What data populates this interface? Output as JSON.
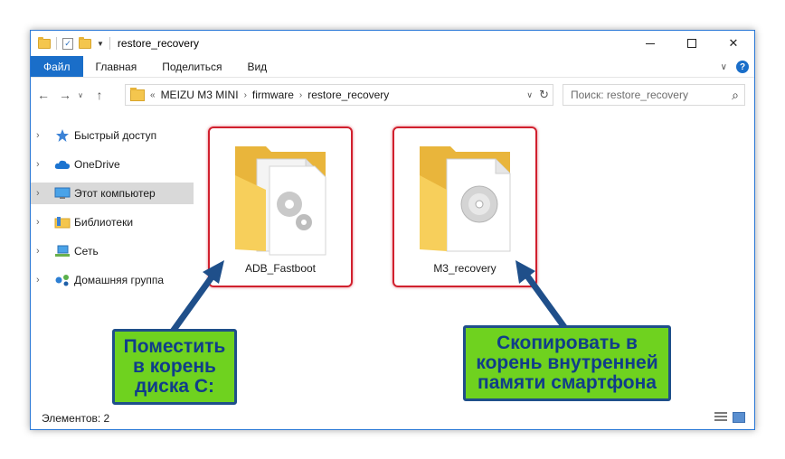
{
  "window": {
    "title": "restore_recovery",
    "minimize": "—",
    "maximize": "□",
    "close": "✕"
  },
  "ribbon": {
    "tabs": [
      "Файл",
      "Главная",
      "Поделиться",
      "Вид"
    ],
    "collapse": "∨",
    "help": "?"
  },
  "nav": {
    "back": "←",
    "forward": "→",
    "recent": "∨",
    "up": "↑"
  },
  "address": {
    "overflow": "«",
    "crumbs": [
      "MEIZU M3 MINI",
      "firmware",
      "restore_recovery"
    ],
    "separator": "›",
    "dropdown": "∨",
    "refresh": "↻"
  },
  "search": {
    "placeholder": "Поиск: restore_recovery",
    "icon": "search-icon"
  },
  "sidebar": {
    "items": [
      {
        "label": "Быстрый доступ",
        "icon": "star-icon"
      },
      {
        "label": "OneDrive",
        "icon": "cloud-icon"
      },
      {
        "label": "Этот компьютер",
        "icon": "computer-icon"
      },
      {
        "label": "Библиотеки",
        "icon": "library-icon"
      },
      {
        "label": "Сеть",
        "icon": "network-icon"
      },
      {
        "label": "Домашняя группа",
        "icon": "homegroup-icon"
      }
    ],
    "selected_index": 2
  },
  "files": [
    {
      "name": "ADB_Fastboot",
      "icon": "folder-gears-icon"
    },
    {
      "name": "M3_recovery",
      "icon": "folder-disc-icon"
    }
  ],
  "status": {
    "items_count": "Элементов: 2"
  },
  "callouts": {
    "left": [
      "Поместить",
      "в корень",
      "диска С:"
    ],
    "right": [
      "Скопировать в",
      "корень внутренней",
      "памяти смартфона"
    ]
  },
  "colors": {
    "accent": "#1a6ec9",
    "highlight_border": "#d1202e",
    "callout_fill": "#6fd21f",
    "callout_text": "#103d8a",
    "arrow": "#1f4f8a",
    "folder": "#f4c64e"
  }
}
